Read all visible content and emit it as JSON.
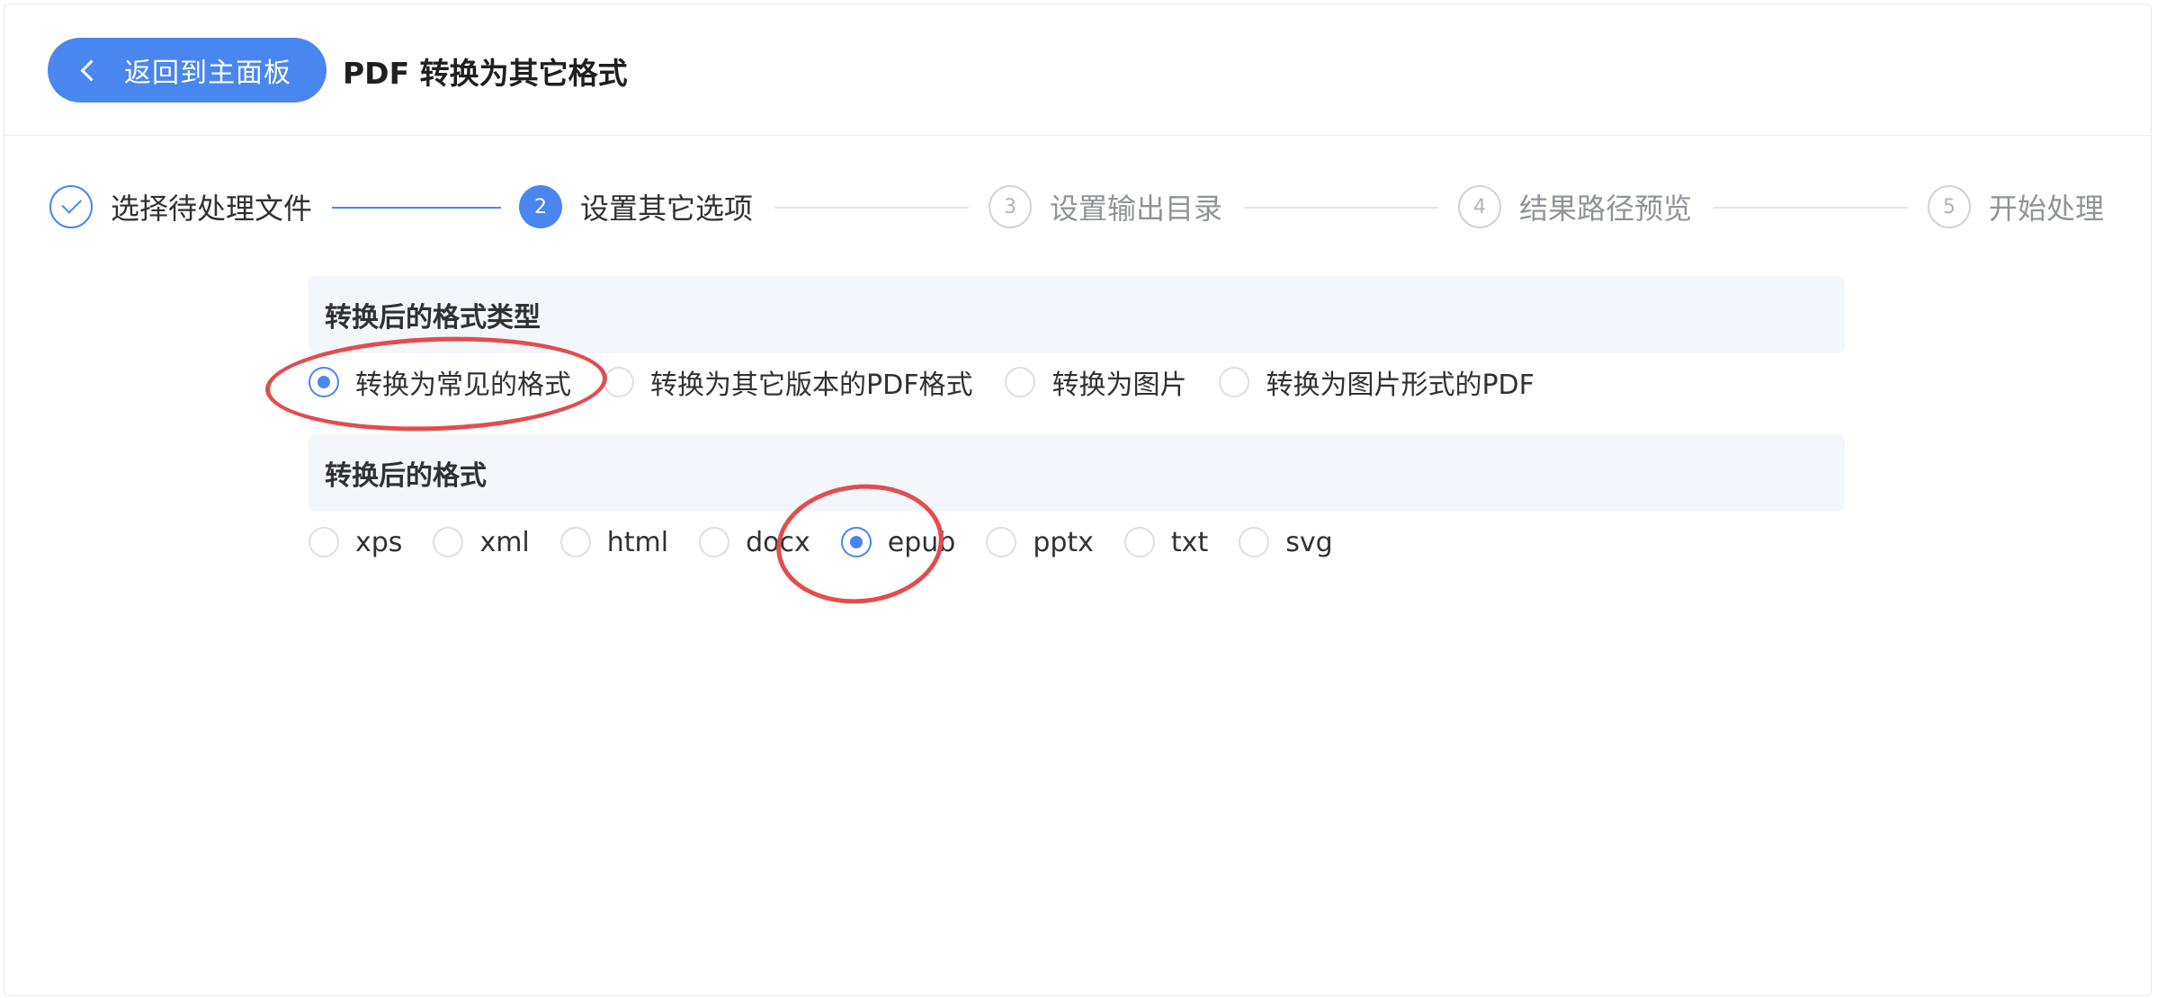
{
  "header": {
    "back_label": "返回到主面板",
    "title": "PDF 转换为其它格式"
  },
  "steps": [
    {
      "num": "1",
      "label": "选择待处理文件",
      "state": "done"
    },
    {
      "num": "2",
      "label": "设置其它选项",
      "state": "active"
    },
    {
      "num": "3",
      "label": "设置输出目录",
      "state": "pending"
    },
    {
      "num": "4",
      "label": "结果路径预览",
      "state": "pending"
    },
    {
      "num": "5",
      "label": "开始处理",
      "state": "pending"
    }
  ],
  "format_type": {
    "heading": "转换后的格式类型",
    "options": [
      "转换为常见的格式",
      "转换为其它版本的PDF格式",
      "转换为图片",
      "转换为图片形式的PDF"
    ],
    "selected": "转换为常见的格式"
  },
  "format": {
    "heading": "转换后的格式",
    "options": [
      "xps",
      "xml",
      "html",
      "docx",
      "epub",
      "pptx",
      "txt",
      "svg"
    ],
    "selected": "epub"
  },
  "colors": {
    "accent": "#4a86f0",
    "annotation": "#e24d4d"
  }
}
